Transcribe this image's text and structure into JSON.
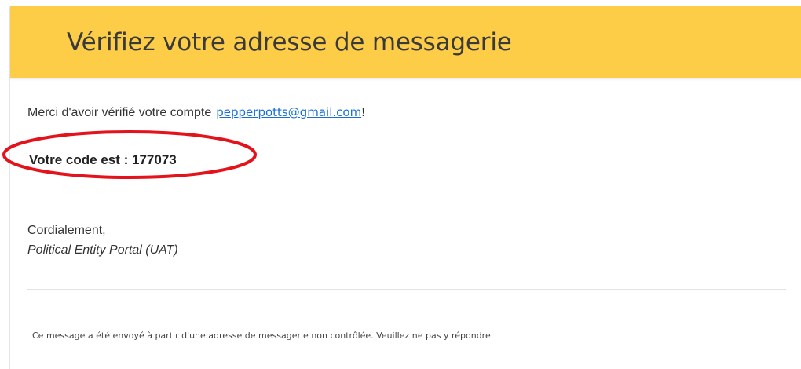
{
  "header": {
    "title": "Vérifiez votre adresse de messagerie",
    "background_color": "#fdcd47"
  },
  "body": {
    "greeting": "Merci d'avoir vérifié votre compte",
    "email_address": "pepperpotts@gmail.com",
    "greeting_end": "!",
    "code_line": "Votre code est : 177073",
    "sign_off": "Cordialement,",
    "sender": "Political Entity Portal (UAT)"
  },
  "footer": {
    "note": "Ce message a été envoyé à partir d'une adresse de messagerie non contrôlée. Veuillez ne pas y répondre."
  },
  "annotation": {
    "ellipse_color": "#e3121b"
  },
  "colors": {
    "link": "#1a6fd6",
    "text": "#333333"
  }
}
